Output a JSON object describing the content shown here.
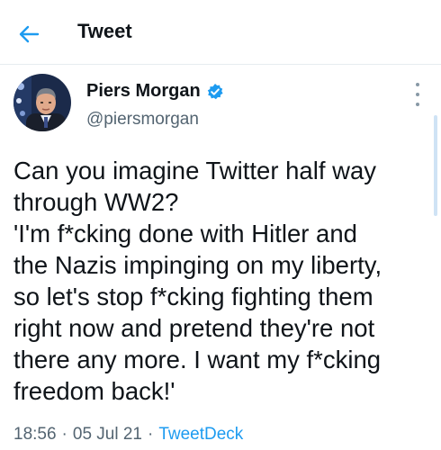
{
  "header": {
    "title": "Tweet"
  },
  "tweet": {
    "author": {
      "name": "Piers Morgan",
      "handle": "@piersmorgan",
      "verified": true
    },
    "text_lines": [
      "Can you imagine Twitter half way",
      "through WW2?",
      "'I'm f*cking done with Hitler and",
      "the Nazis impinging on my liberty,",
      "so let's stop f*cking fighting them",
      "right  now and pretend they're not",
      "there any more. I want my f*cking",
      "freedom back!'"
    ],
    "time": "18:56",
    "date": "05 Jul 21",
    "source": "TweetDeck",
    "separator": "·"
  },
  "colors": {
    "accent": "#1d9bf0",
    "text": "#0f1419",
    "secondary": "#536471"
  },
  "icons": {
    "back": "back-arrow-icon",
    "verified": "verified-badge-icon",
    "more": "more-vertical-icon"
  }
}
